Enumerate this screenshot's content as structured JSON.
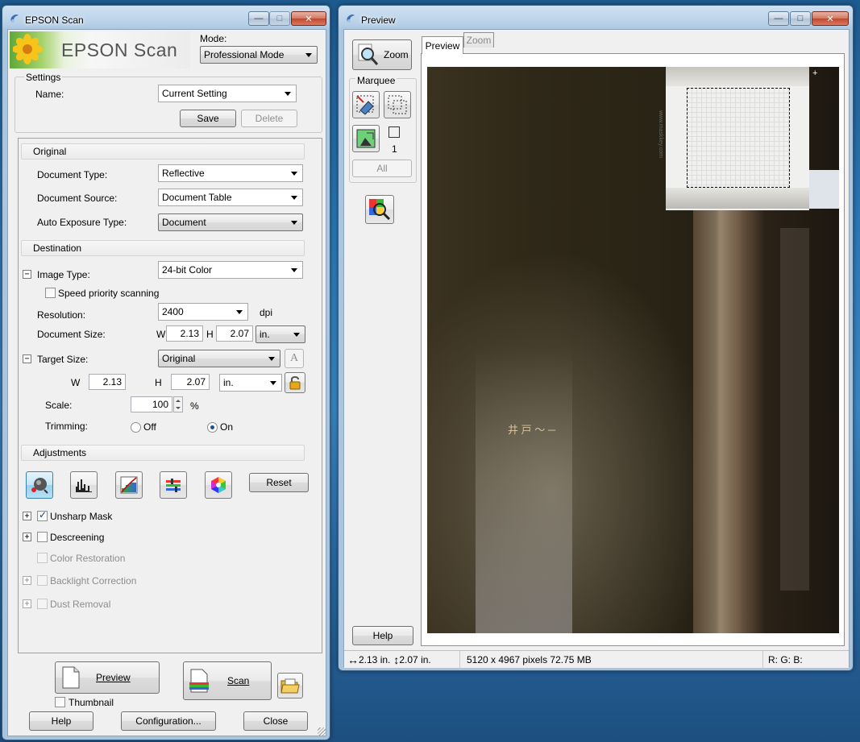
{
  "main_window": {
    "title": "EPSON Scan",
    "logo_text": "EPSON Scan",
    "mode": {
      "label": "Mode:",
      "value": "Professional Mode"
    },
    "settings": {
      "group_label": "Settings",
      "name_label": "Name:",
      "name_value": "Current Setting",
      "save_label": "Save",
      "delete_label": "Delete"
    },
    "original": {
      "header": "Original",
      "document_type_label": "Document Type:",
      "document_type_value": "Reflective",
      "document_source_label": "Document Source:",
      "document_source_value": "Document Table",
      "auto_exposure_label": "Auto Exposure Type:",
      "auto_exposure_value": "Document"
    },
    "destination": {
      "header": "Destination",
      "image_type_label": "Image Type:",
      "image_type_value": "24-bit Color",
      "speed_priority_label": "Speed priority scanning",
      "resolution_label": "Resolution:",
      "resolution_value": "2400",
      "resolution_unit": "dpi",
      "document_size_label": "Document Size:",
      "w_label": "W",
      "w_value": "2.13",
      "h_label": "H",
      "h_value": "2.07",
      "size_unit": "in.",
      "target_size_label": "Target Size:",
      "target_size_value": "Original",
      "target_w_label": "W",
      "target_w_value": "2.13",
      "target_h_label": "H",
      "target_h_value": "2.07",
      "target_unit": "in.",
      "scale_label": "Scale:",
      "scale_value": "100",
      "scale_unit": "%",
      "trimming_label": "Trimming:",
      "trimming_off": "Off",
      "trimming_on": "On",
      "trimming_selected": "On"
    },
    "adjustments": {
      "header": "Adjustments",
      "reset_label": "Reset",
      "tools": [
        "auto-exposure",
        "histogram-adjustment",
        "tone-correction",
        "image-adjustment",
        "color-palette"
      ],
      "options": [
        {
          "label": "Unsharp Mask",
          "checked": true,
          "enabled": true,
          "expander": true
        },
        {
          "label": "Descreening",
          "checked": false,
          "enabled": true,
          "expander": true
        },
        {
          "label": "Color Restoration",
          "checked": false,
          "enabled": false,
          "expander": false
        },
        {
          "label": "Backlight Correction",
          "checked": false,
          "enabled": false,
          "expander": true
        },
        {
          "label": "Dust Removal",
          "checked": false,
          "enabled": false,
          "expander": true
        }
      ]
    },
    "footer": {
      "preview_label": "Preview",
      "scan_label": "Scan",
      "thumbnail_label": "Thumbnail",
      "help_label": "Help",
      "configuration_label": "Configuration...",
      "close_label": "Close"
    }
  },
  "preview_window": {
    "title": "Preview",
    "zoom_label": "Zoom",
    "marquee_label": "Marquee",
    "marquee_count": "1",
    "all_label": "All",
    "help_label": "Help",
    "tabs": [
      "Preview",
      "Zoom"
    ],
    "active_tab": "Preview",
    "status": {
      "width": "2.13 in.",
      "height": "2.07 in.",
      "pixels": "5120 x 4967 pixels 72.75 MB",
      "rgb": "R: G: B:"
    },
    "scan_overlay_text": "www.maskkey.com"
  },
  "colors": {
    "scan_background": "#2e2718",
    "selection_border": "#000000",
    "window_frame": "#aac5df"
  }
}
